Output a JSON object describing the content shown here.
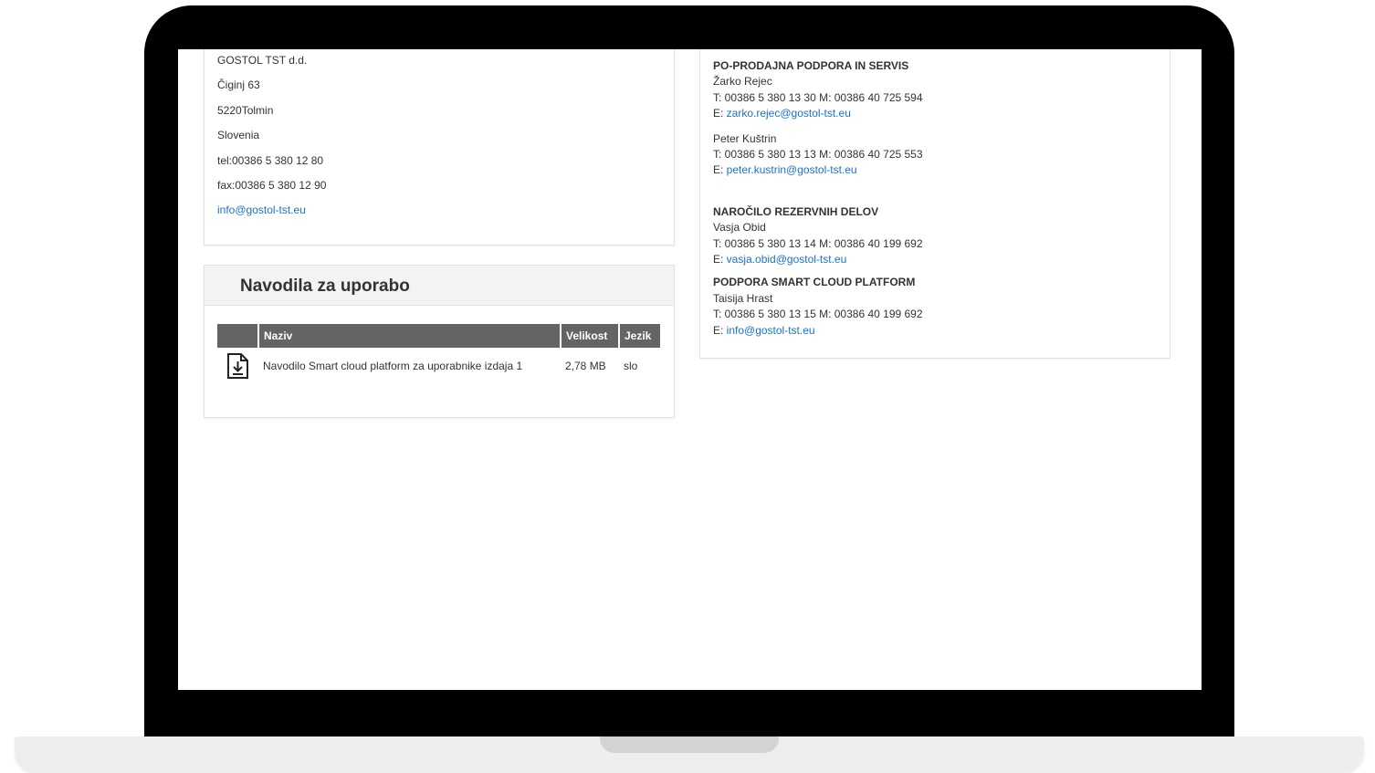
{
  "company": {
    "name": "GOSTOL TST d.d.",
    "street": "Čiginj 63",
    "city": "5220Tolmin",
    "country": "Slovenia",
    "tel": "tel:00386 5 380 12 80",
    "fax": "fax:00386 5 380 12 90",
    "email": "info@gostol-tst.eu"
  },
  "manuals": {
    "title": "Navodila za uporabo",
    "columns": [
      "",
      "Naziv",
      "Velikost",
      "Jezik"
    ],
    "rows": [
      {
        "icon": "download-icon",
        "name": "Navodilo Smart cloud platform za uporabnike izdaja 1",
        "size": "2,78 MB",
        "lang": "slo"
      }
    ]
  },
  "contacts": {
    "sections": [
      {
        "title": "PO-PRODAJNA PODPORA IN SERVIS",
        "people": [
          {
            "name": "Žarko Rejec",
            "phone": "T: 00386 5 380 13 30   M: 00386 40 725 594",
            "email_prefix": "E: ",
            "email": "zarko.rejec@gostol-tst.eu"
          },
          {
            "name": "Peter Kuštrin",
            "phone": "T: 00386 5 380 13 13   M: 00386 40 725 553",
            "email_prefix": "E: ",
            "email": "peter.kustrin@gostol-tst.eu"
          }
        ]
      },
      {
        "title": "NAROČILO REZERVNIH DELOV",
        "people": [
          {
            "name": "Vasja Obid",
            "phone": "T: 00386 5 380 13 14 M: 00386 40 199 692",
            "email_prefix": "E: ",
            "email": "vasja.obid@gostol-tst.eu"
          }
        ]
      },
      {
        "title": "PODPORA SMART CLOUD PLATFORM",
        "people": [
          {
            "name": "Taisija Hrast",
            "phone": "T: 00386 5 380 13 15 M: 00386 40 199 692",
            "email_prefix": "E: ",
            "email": "info@gostol-tst.eu"
          }
        ]
      }
    ]
  },
  "colors": {
    "link": "#1a73c9",
    "table_header": "#646464",
    "bezel": "#000000"
  }
}
